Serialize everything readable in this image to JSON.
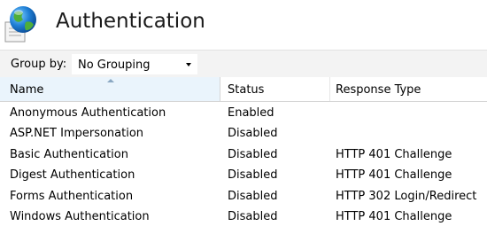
{
  "page": {
    "title": "Authentication",
    "icon": "authentication-feature-icon"
  },
  "toolbar": {
    "group_by_label": "Group by:",
    "group_by_value": "No Grouping"
  },
  "grid": {
    "columns": [
      "Name",
      "Status",
      "Response Type"
    ],
    "sorted_column": "Name",
    "rows": [
      {
        "name": "Anonymous Authentication",
        "status": "Enabled",
        "response_type": ""
      },
      {
        "name": "ASP.NET Impersonation",
        "status": "Disabled",
        "response_type": ""
      },
      {
        "name": "Basic Authentication",
        "status": "Disabled",
        "response_type": "HTTP 401 Challenge"
      },
      {
        "name": "Digest Authentication",
        "status": "Disabled",
        "response_type": "HTTP 401 Challenge"
      },
      {
        "name": "Forms Authentication",
        "status": "Disabled",
        "response_type": "HTTP 302 Login/Redirect"
      },
      {
        "name": "Windows Authentication",
        "status": "Disabled",
        "response_type": "HTTP 401 Challenge"
      }
    ]
  },
  "colors": {
    "toolbar_background": "#f3f3f3",
    "sorted_header_background": "#eaf4fc",
    "header_divider": "#d5d5d5"
  }
}
